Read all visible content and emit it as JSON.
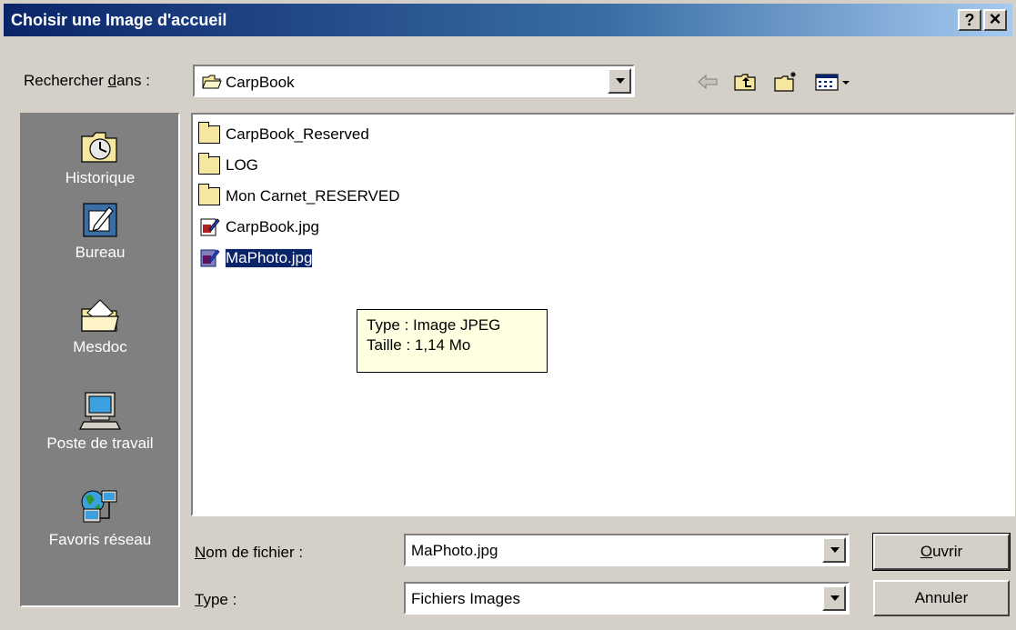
{
  "window": {
    "title": "Choisir une Image d'accueil",
    "help_label": "?",
    "close_label": "×"
  },
  "lookin": {
    "label_prefix": "Rechercher ",
    "label_accel": "d",
    "label_suffix": "ans :",
    "value": "CarpBook"
  },
  "toolbar": {
    "icons": [
      "back-arrow-icon",
      "up-folder-icon",
      "new-folder-icon",
      "view-menu-icon"
    ]
  },
  "places": [
    {
      "label": "Historique",
      "icon": "history-clock-icon"
    },
    {
      "label": "Bureau",
      "icon": "desktop-icon"
    },
    {
      "label": "Mesdoc",
      "icon": "my-documents-icon"
    },
    {
      "label": "Poste de travail",
      "icon": "my-computer-icon"
    },
    {
      "label": "Favoris réseau",
      "icon": "network-places-icon"
    }
  ],
  "files": [
    {
      "name": "CarpBook_Reserved",
      "type": "folder",
      "selected": false
    },
    {
      "name": "LOG",
      "type": "folder",
      "selected": false
    },
    {
      "name": "Mon Carnet_RESERVED",
      "type": "folder",
      "selected": false
    },
    {
      "name": "CarpBook.jpg",
      "type": "jpg",
      "selected": false
    },
    {
      "name": "MaPhoto.jpg",
      "type": "jpg",
      "selected": true
    }
  ],
  "tooltip": {
    "line1": "Type : Image JPEG",
    "line2": "Taille  : 1,14 Mo"
  },
  "filename": {
    "label_accel": "N",
    "label_rest": "om de fichier :",
    "value": "MaPhoto.jpg"
  },
  "filetype": {
    "label_accel": "T",
    "label_rest": "ype :",
    "value": "Fichiers Images"
  },
  "buttons": {
    "open_accel": "O",
    "open_rest": "uvrir",
    "cancel": "Annuler"
  },
  "colors": {
    "title_bar": "#0a246a",
    "selection": "#0a246a",
    "tooltip_bg": "#ffffe1",
    "sidebar_bg": "#808080"
  }
}
